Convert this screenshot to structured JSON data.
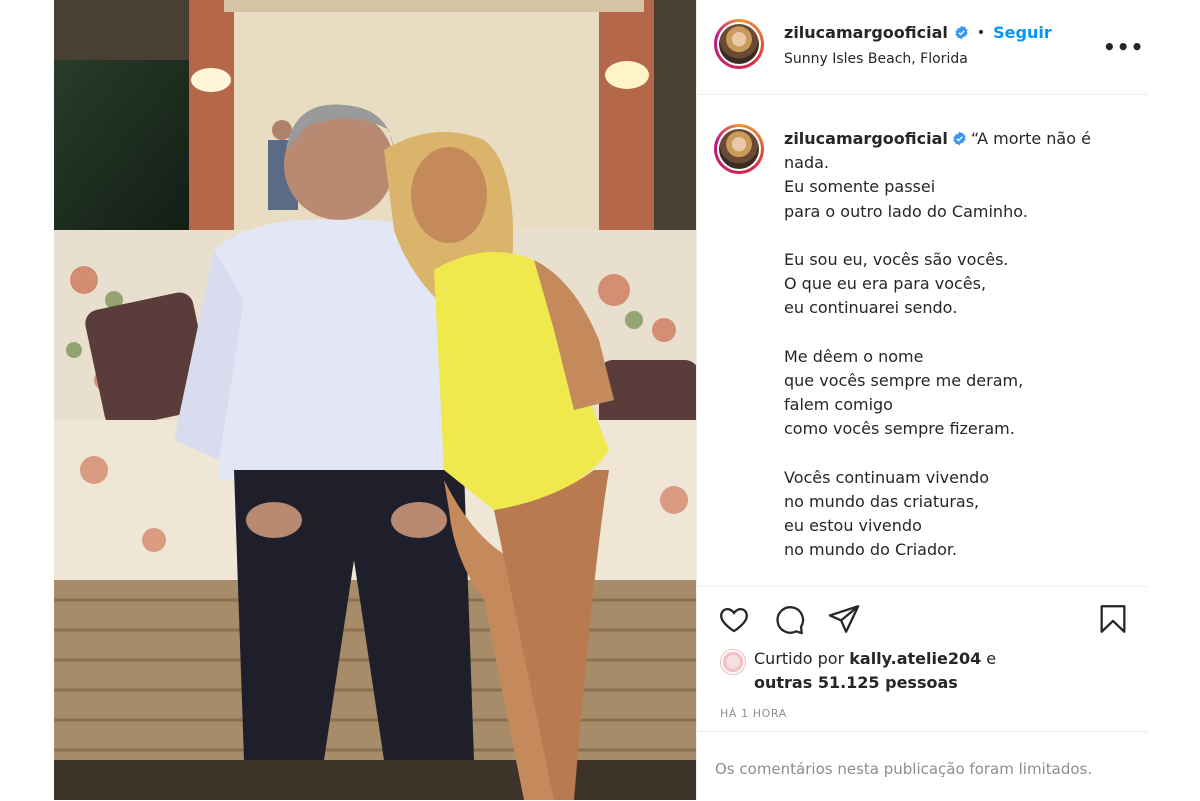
{
  "post": {
    "username": "zilucamargooficial",
    "dot": "•",
    "follow_label": "Seguir",
    "location": "Sunny Isles Beach, Florida",
    "more_label": "•••"
  },
  "caption": {
    "username": "zilucamargooficial",
    "text": "“A morte não é nada.\nEu somente passei\npara o outro lado do Caminho.\n\nEu sou eu, vocês são vocês.\nO que eu era para vocês,\neu continuarei sendo.\n\nMe dêem o nome\nque vocês sempre me deram,\nfalem comigo\ncomo vocês sempre fizeram.\n\nVocês continuam vivendo\nno mundo das criaturas,\neu estou vivendo\nno mundo do Criador."
  },
  "likes": {
    "prefix": "Curtido por ",
    "user": "kally.atelie204",
    "suffix": " e",
    "others": "outras 51.125 pessoas"
  },
  "timestamp": "HÁ 1 HORA",
  "comments_notice": "Os comentários nesta publicação foram limitados.",
  "icons": {
    "like": "heart-icon",
    "comment": "comment-icon",
    "share": "share-icon",
    "save": "bookmark-icon",
    "verified": "verified-badge-icon"
  },
  "colors": {
    "follow": "#0095f6",
    "verified": "#3897f0",
    "muted": "#8e8e8e",
    "text": "#262626"
  }
}
